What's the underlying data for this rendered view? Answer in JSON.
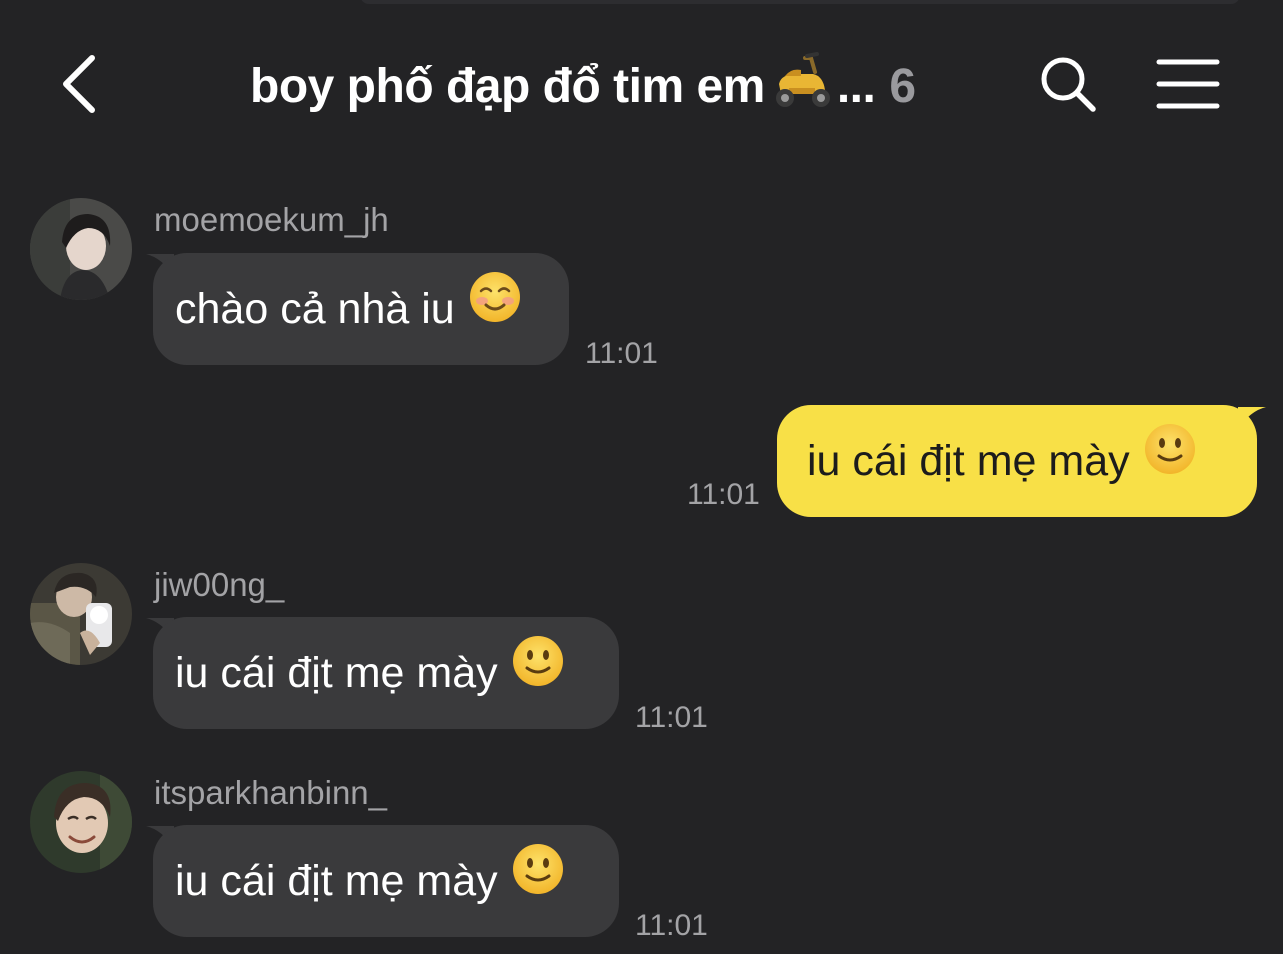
{
  "header": {
    "title": "boy phố đạp đổ tim em",
    "title_suffix": "...",
    "member_count": "6",
    "icons": [
      "back-chevron-icon",
      "scooter-emoji-icon",
      "search-icon",
      "menu-icon"
    ]
  },
  "messages": [
    {
      "sender": "moemoekum_jh",
      "text": "chào cả nhà iu",
      "emoji": "smiling-face-icon",
      "time": "11:01",
      "mine": false
    },
    {
      "sender": "",
      "text": "iu cái địt mẹ mày",
      "emoji": "slightly-smiling-face-icon",
      "time": "11:01",
      "mine": true
    },
    {
      "sender": "jiw00ng_",
      "text": "iu cái địt mẹ mày",
      "emoji": "slightly-smiling-face-icon",
      "time": "11:01",
      "mine": false
    },
    {
      "sender": "itsparkhanbinn_",
      "text": "iu cái địt mẹ mày",
      "emoji": "slightly-smiling-face-icon",
      "time": "11:01",
      "mine": false
    }
  ],
  "colors": {
    "background": "#232325",
    "incoming_bubble": "#3a3a3c",
    "outgoing_bubble": "#f8e047",
    "secondary_text": "#a3a3a6"
  }
}
